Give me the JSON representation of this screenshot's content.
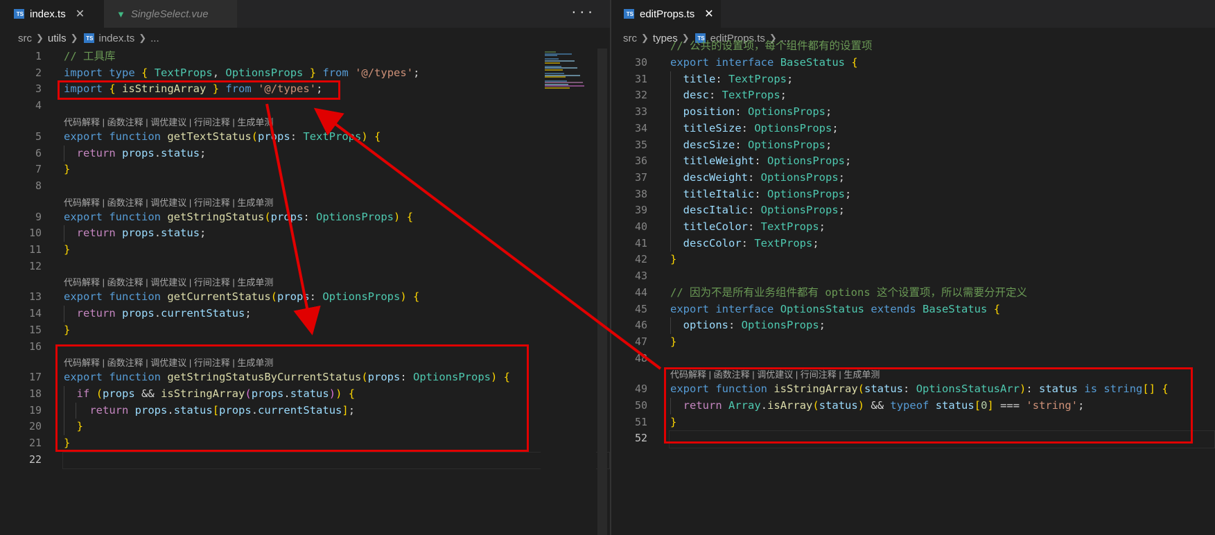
{
  "left": {
    "tabs": [
      {
        "icon": "typescript-file-icon",
        "label": "index.ts",
        "close": "✕",
        "state": "active"
      },
      {
        "icon": "vue-file-icon",
        "label": "SingleSelect.vue",
        "state": "inactive"
      }
    ],
    "more_actions": "···",
    "breadcrumb": [
      "src",
      "utils",
      "index.ts",
      "..."
    ],
    "codelens": "代码解释 | 函数注释 | 调优建议 | 行间注释 | 生成单测",
    "lines": [
      {
        "n": "1",
        "text": "// 工具库"
      },
      {
        "n": "2",
        "text": "import type { TextProps, OptionsProps } from '@/types';"
      },
      {
        "n": "3",
        "text": "import { isStringArray } from '@/types';"
      },
      {
        "n": "4",
        "text": ""
      },
      {
        "n": "5",
        "text": "export function getTextStatus(props: TextProps) {"
      },
      {
        "n": "6",
        "text": "  return props.status;"
      },
      {
        "n": "7",
        "text": "}"
      },
      {
        "n": "8",
        "text": ""
      },
      {
        "n": "9",
        "text": "export function getStringStatus(props: OptionsProps) {"
      },
      {
        "n": "10",
        "text": "  return props.status;"
      },
      {
        "n": "11",
        "text": "}"
      },
      {
        "n": "12",
        "text": ""
      },
      {
        "n": "13",
        "text": "export function getCurrentStatus(props: OptionsProps) {"
      },
      {
        "n": "14",
        "text": "  return props.currentStatus;"
      },
      {
        "n": "15",
        "text": "}"
      },
      {
        "n": "16",
        "text": ""
      },
      {
        "n": "17",
        "text": "export function getStringStatusByCurrentStatus(props: OptionsProps) {"
      },
      {
        "n": "18",
        "text": "  if (props && isStringArray(props.status)) {"
      },
      {
        "n": "19",
        "text": "    return props.status[props.currentStatus];"
      },
      {
        "n": "20",
        "text": "  }"
      },
      {
        "n": "21",
        "text": "}"
      },
      {
        "n": "22",
        "text": ""
      }
    ]
  },
  "right": {
    "tabs": [
      {
        "icon": "typescript-file-icon",
        "label": "editProps.ts",
        "close": "✕",
        "state": "active"
      }
    ],
    "breadcrumb": [
      "src",
      "types",
      "editProps.ts",
      "..."
    ],
    "codelens": "代码解释 | 函数注释 | 调优建议 | 行间注释 | 生成单测",
    "partial_top": "// 公共的设置项，每个组件都有的设置项",
    "lines": [
      {
        "n": "29",
        "text": ""
      },
      {
        "n": "30",
        "text": "export interface BaseStatus {"
      },
      {
        "n": "31",
        "text": "  title: TextProps;"
      },
      {
        "n": "32",
        "text": "  desc: TextProps;"
      },
      {
        "n": "33",
        "text": "  position: OptionsProps;"
      },
      {
        "n": "34",
        "text": "  titleSize: OptionsProps;"
      },
      {
        "n": "35",
        "text": "  descSize: OptionsProps;"
      },
      {
        "n": "36",
        "text": "  titleWeight: OptionsProps;"
      },
      {
        "n": "37",
        "text": "  descWeight: OptionsProps;"
      },
      {
        "n": "38",
        "text": "  titleItalic: OptionsProps;"
      },
      {
        "n": "39",
        "text": "  descItalic: OptionsProps;"
      },
      {
        "n": "40",
        "text": "  titleColor: TextProps;"
      },
      {
        "n": "41",
        "text": "  descColor: TextProps;"
      },
      {
        "n": "42",
        "text": "}"
      },
      {
        "n": "43",
        "text": ""
      },
      {
        "n": "44",
        "text": "// 因为不是所有业务组件都有 options 这个设置项，所以需要分开定义"
      },
      {
        "n": "45",
        "text": "export interface OptionsStatus extends BaseStatus {"
      },
      {
        "n": "46",
        "text": "  options: OptionsProps;"
      },
      {
        "n": "47",
        "text": "}"
      },
      {
        "n": "48",
        "text": ""
      },
      {
        "n": "49",
        "text": "export function isStringArray(status: OptionsStatusArr): status is string[] {"
      },
      {
        "n": "50",
        "text": "  return Array.isArray(status) && typeof status[0] === 'string';"
      },
      {
        "n": "51",
        "text": "}"
      },
      {
        "n": "52",
        "text": ""
      }
    ]
  },
  "colors": {
    "background": "#1e1e1e",
    "tab_bar": "#252526",
    "annotation_red": "#e00000",
    "keyword": "#569cd6",
    "control": "#c586c0",
    "function": "#dcdcaa",
    "type": "#4ec9b0",
    "variable": "#9cdcfe",
    "string": "#ce9178",
    "comment": "#6a9955"
  },
  "annotations": {
    "boxes": [
      "import-line-highlight",
      "getStringStatusByCurrentStatus-highlight",
      "isStringArray-definition-highlight"
    ],
    "arrows": [
      "definition-to-import-arrow",
      "import-to-usage-arrow"
    ]
  }
}
